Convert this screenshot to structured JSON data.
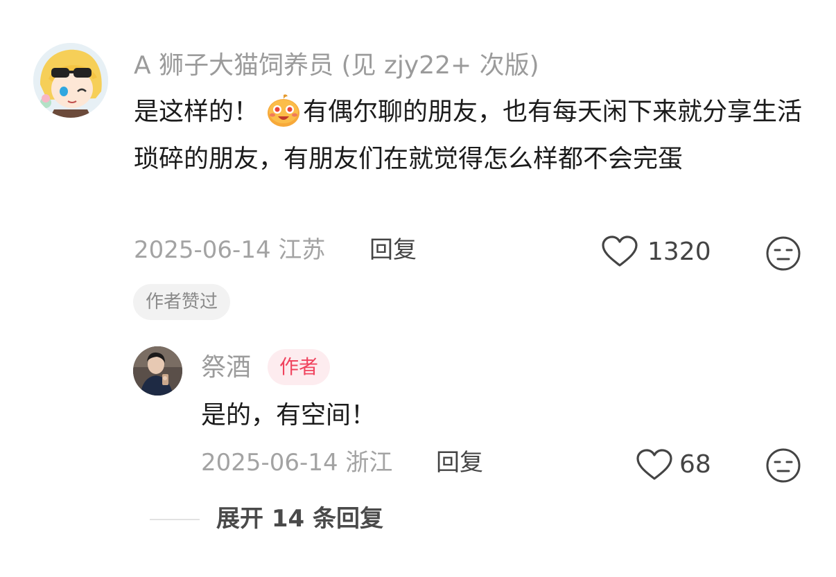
{
  "comment": {
    "username": "A 狮子大猫饲养员 (见 zjy22+ 次版)",
    "text_before_emoji": "是这样的！",
    "emoji_icon": "grinning-blushing-emoji",
    "text_after_emoji": "有偶尔聊的朋友，也有每天闲下来就分享生活琐碎的朋友，有朋友们在就觉得怎么样都不会完蛋",
    "date": "2025-06-14",
    "location": "江苏",
    "reply_label": "回复",
    "likes": "1320",
    "author_liked_chip": "作者赞过"
  },
  "reply": {
    "username": "祭酒",
    "author_badge": "作者",
    "text": "是的，有空间！",
    "date": "2025-06-14",
    "location": "浙江",
    "reply_label": "回复",
    "likes": "68"
  },
  "expand_replies": "展开 14 条回复",
  "icons": {
    "like": "heart-outline-icon",
    "dislike": "neutral-face-icon"
  },
  "colors": {
    "secondary_text": "#9b9b9b",
    "author_badge_bg": "#fdecef",
    "author_badge_text": "#f0435e",
    "chip_bg": "#f2f2f2"
  }
}
